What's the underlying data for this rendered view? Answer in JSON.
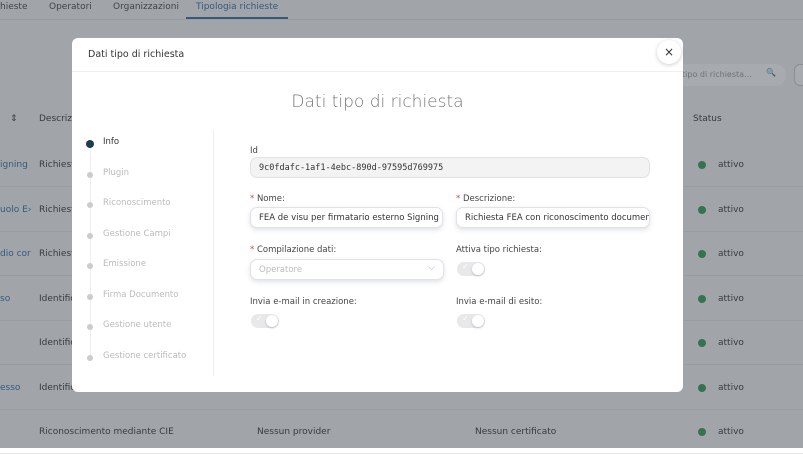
{
  "tabs": [
    "hieste",
    "Operatori",
    "Organizzazioni",
    "Tipologia richieste"
  ],
  "search": {
    "placeholder": "tipo di richiesta..."
  },
  "table": {
    "headers": {
      "description": "Descrizi",
      "status": "Status"
    },
    "rows": [
      {
        "name": "igning",
        "desc": "Richiesta",
        "status": "attivo"
      },
      {
        "name": "uolo E›",
        "desc": "Richiesta",
        "status": "attivo"
      },
      {
        "name": "dio cor",
        "desc": "Richiesta",
        "status": "attivo"
      },
      {
        "name": "so",
        "desc": "Identific",
        "status": "attivo"
      },
      {
        "name": "",
        "desc": "Identific",
        "status": "attivo"
      },
      {
        "name": "esso",
        "desc": "Identific",
        "status": "attivo"
      },
      {
        "name": "",
        "desc": "Riconoscimento mediante CIE",
        "plugin": "Nessun provider",
        "cert": "Nessun certificato",
        "status": "attivo"
      }
    ]
  },
  "modal": {
    "header": "Dati tipo di richiesta",
    "close": "×",
    "title": "Dati tipo di richiesta",
    "steps": [
      "Info",
      "Plugin",
      "Riconoscimento",
      "Gestione Campi",
      "Emissione",
      "Firma Documento",
      "Gestione utente",
      "Gestione certificato"
    ],
    "form": {
      "id_label": "Id",
      "id_value": "9c0fdafc-1af1-4ebc-890d-97595d769975",
      "nome_label": "Nome:",
      "nome_value": "FEA de visu per firmatario esterno Signing",
      "desc_label": "Descrizione:",
      "desc_value": "Richiesta FEA con riconoscimento document",
      "compilazione_label": "Compilazione dati:",
      "compilazione_value": "Operatore",
      "attiva_label": "Attiva tipo richiesta:",
      "email_creazione_label": "Invia e-mail in creazione:",
      "email_esito_label": "Invia e-mail di esito:",
      "required_mark": "*"
    }
  },
  "colors": {
    "accent": "#2a6fa3",
    "active": "#2e9a55"
  }
}
